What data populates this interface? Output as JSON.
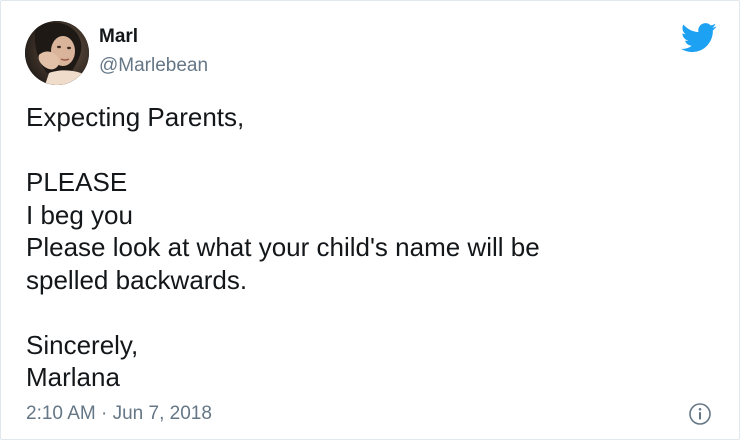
{
  "user": {
    "display_name": "Marl",
    "handle": "@Marlebean"
  },
  "tweet": {
    "text": "Expecting Parents,\n\nPLEASE\nI beg you\nPlease look at what your child's name will be\nspelled backwards.\n\nSincerely,\nMarlana",
    "timestamp": "2:10 AM · Jun 7, 2018"
  },
  "icons": {
    "brand": "twitter-bird-icon",
    "info": "info-icon"
  },
  "colors": {
    "brand": "#1da1f2",
    "secondary_text": "#657786",
    "primary_text": "#14171a"
  }
}
